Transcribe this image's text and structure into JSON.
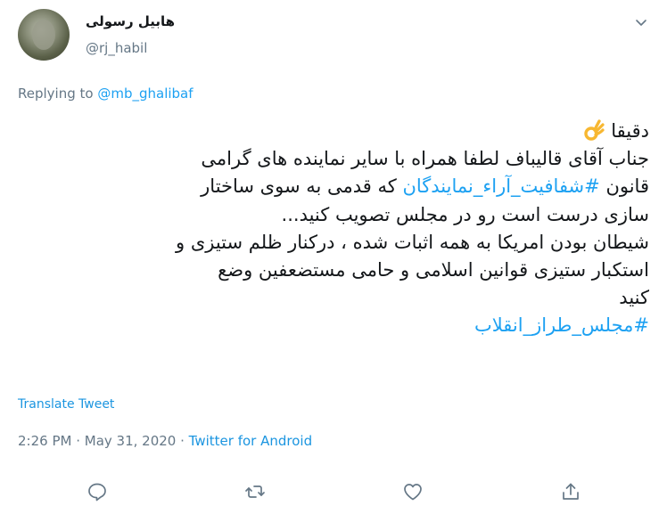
{
  "author": {
    "display_name": "هابیل رسولی",
    "handle": "@rj_habil"
  },
  "reply": {
    "prefix": "Replying to ",
    "mention": "@mb_ghalibaf"
  },
  "tweet": {
    "line1": "دقیقا",
    "line2": "جناب آقای قالیباف لطفا همراه با سایر نماینده های گرامی",
    "line3_prefix": "قانون ",
    "line3_hashtag": "#شفافیت_آراء_نمایندگان",
    "line3_suffix": " که قدمی به سوی ساختار",
    "line4": "سازی درست است رو در مجلس تصویب کنید...",
    "line5": "شیطان بودن امریکا به همه اثبات شده ، درکنار ظلم ستیزی و",
    "line6": "استکبار ستیزی قوانین اسلامی و حامی مستضعفین وضع",
    "line7": "کنید",
    "line8_hashtag": "#مجلس_طراز_انقلاب"
  },
  "translate_label": "Translate Tweet",
  "meta": {
    "time": "2:26 PM",
    "separator1": " · ",
    "date": "May 31, 2020",
    "separator2": " · ",
    "source": "Twitter for Android"
  },
  "icons": {
    "more": "chevron-down-icon",
    "reply": "reply-icon",
    "retweet": "retweet-icon",
    "like": "heart-icon",
    "share": "share-icon",
    "emoji": "ok-hand-emoji-icon"
  },
  "colors": {
    "link": "#1da1f2",
    "secondary": "#657786",
    "text": "#14171a"
  }
}
